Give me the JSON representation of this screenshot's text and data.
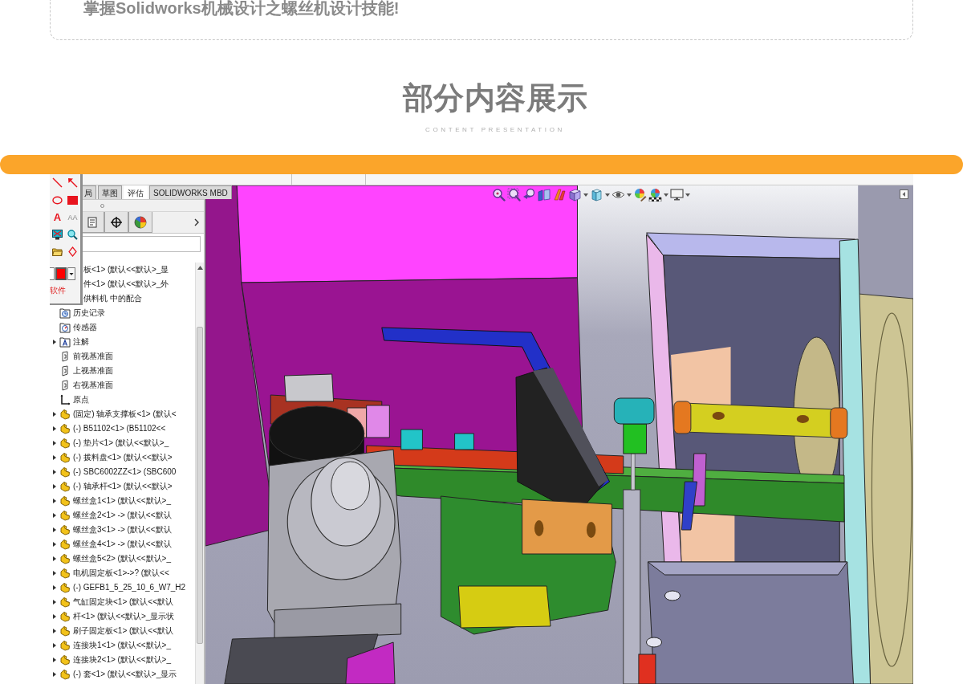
{
  "intro": {
    "text": "掌握Solidworks机械设计之螺丝机设计技能!"
  },
  "section": {
    "title": "部分内容展示",
    "subtitle": "CONTENT PRESENTATION"
  },
  "screenshot": {
    "annotation_tool": {
      "text_tools": [
        {
          "kind": "solid",
          "label": "A"
        },
        {
          "kind": "outline",
          "label": "AA"
        }
      ],
      "color": "#ff0000",
      "label": "软件"
    },
    "tabs": [
      {
        "label": "局",
        "selected": false
      },
      {
        "label": "草图",
        "selected": false
      },
      {
        "label": "评估",
        "selected": true
      },
      {
        "label": "SOLIDWORKS MBD",
        "selected": false
      }
    ],
    "feature_tree": {
      "items": [
        {
          "label": "板<1> (默认<<默认>_显",
          "kind": "clipped"
        },
        {
          "label": "件<1> (默认<<默认>_外",
          "kind": "clipped"
        },
        {
          "label": "供料机 中的配合",
          "kind": "clipped"
        },
        {
          "label": "历史记录",
          "kind": "history"
        },
        {
          "label": "传感器",
          "kind": "sensor"
        },
        {
          "label": "注解",
          "kind": "annotation",
          "expanded": false
        },
        {
          "label": "前视基准面",
          "kind": "plane"
        },
        {
          "label": "上视基准面",
          "kind": "plane"
        },
        {
          "label": "右视基准面",
          "kind": "plane"
        },
        {
          "label": "原点",
          "kind": "origin"
        },
        {
          "label": "(固定) 轴承支撑板<1> (默认<",
          "kind": "part",
          "expanded": false
        },
        {
          "label": "(-) B51102<1> (B51102<<",
          "kind": "part",
          "expanded": false
        },
        {
          "label": "(-) 垫片<1> (默认<<默认>_",
          "kind": "part",
          "expanded": false
        },
        {
          "label": "(-) 拨料盘<1> (默认<<默认>",
          "kind": "part",
          "expanded": false
        },
        {
          "label": "(-) SBC6002ZZ<1> (SBC600",
          "kind": "part",
          "expanded": false
        },
        {
          "label": "(-) 轴承杆<1> (默认<<默认>",
          "kind": "part",
          "expanded": false
        },
        {
          "label": "螺丝盒1<1> (默认<<默认>_",
          "kind": "part",
          "expanded": false
        },
        {
          "label": "螺丝盒2<1> -> (默认<<默认",
          "kind": "part",
          "expanded": false
        },
        {
          "label": "螺丝盒3<1> -> (默认<<默认",
          "kind": "part",
          "expanded": false
        },
        {
          "label": "螺丝盒4<1> -> (默认<<默认",
          "kind": "part",
          "expanded": false
        },
        {
          "label": "螺丝盒5<2> (默认<<默认>_",
          "kind": "part",
          "expanded": false
        },
        {
          "label": "电机固定板<1>->? (默认<<",
          "kind": "part",
          "expanded": false
        },
        {
          "label": "(-) GEFB1_5_25_10_6_W7_H2",
          "kind": "part",
          "expanded": false
        },
        {
          "label": "气缸固定块<1> (默认<<默认",
          "kind": "part",
          "expanded": false
        },
        {
          "label": "杆<1> (默认<<默认>_显示状",
          "kind": "part",
          "expanded": false
        },
        {
          "label": "刷子固定板<1> (默认<<默认",
          "kind": "part",
          "expanded": false
        },
        {
          "label": "连接块1<1> (默认<<默认>_",
          "kind": "part",
          "expanded": false
        },
        {
          "label": "连接块2<1> (默认<<默认>_",
          "kind": "part",
          "expanded": false
        },
        {
          "label": "(-) 套<1> (默认<<默认>_显示",
          "kind": "part",
          "expanded": false
        }
      ]
    }
  }
}
